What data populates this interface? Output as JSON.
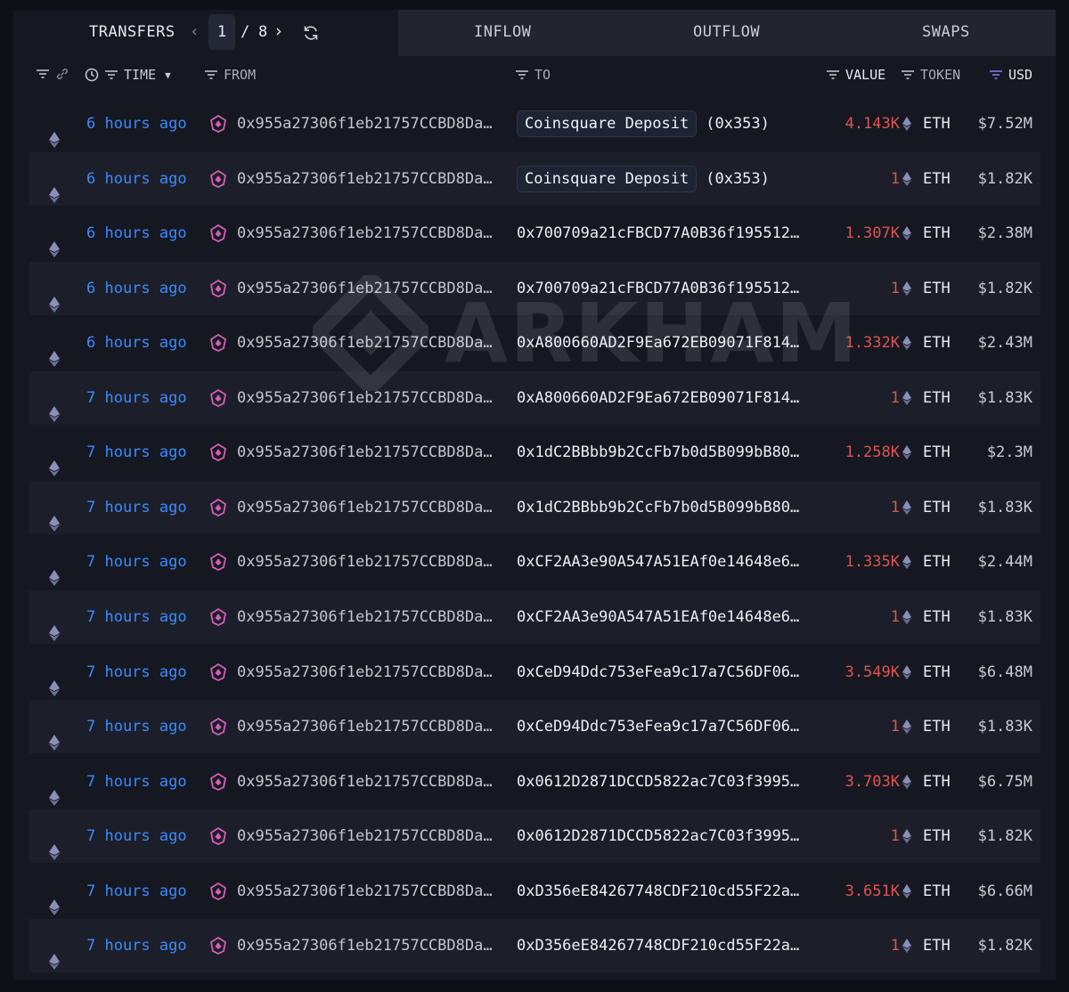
{
  "topbar": {
    "transfers_label": "TRANSFERS",
    "page_current": "1",
    "page_separator": "/",
    "page_total": "8",
    "tabs": [
      {
        "label": "INFLOW"
      },
      {
        "label": "OUTFLOW"
      },
      {
        "label": "SWAPS"
      }
    ]
  },
  "columns": {
    "time": "TIME",
    "from": "FROM",
    "to": "TO",
    "value": "VALUE",
    "token": "TOKEN",
    "usd": "USD"
  },
  "watermark": "ARKHAM",
  "colors": {
    "accent_blue": "#3a8bff",
    "value_red": "#e0534e",
    "usd_filter_purple": "#8b7cff",
    "from_icon_pink": "#d45fb4"
  },
  "rows": [
    {
      "time": "6 hours ago",
      "from": "0x955a27306f1eb21757CCBD8Da…",
      "to_label": "Coinsquare Deposit",
      "to": "(0x353)",
      "value": "4.143K",
      "token": "ETH",
      "usd": "$7.52M"
    },
    {
      "time": "6 hours ago",
      "from": "0x955a27306f1eb21757CCBD8Da…",
      "to_label": "Coinsquare Deposit",
      "to": "(0x353)",
      "value": "1",
      "token": "ETH",
      "usd": "$1.82K"
    },
    {
      "time": "6 hours ago",
      "from": "0x955a27306f1eb21757CCBD8Da…",
      "to_label": "",
      "to": "0x700709a21cFBCD77A0B36f195512…",
      "value": "1.307K",
      "token": "ETH",
      "usd": "$2.38M"
    },
    {
      "time": "6 hours ago",
      "from": "0x955a27306f1eb21757CCBD8Da…",
      "to_label": "",
      "to": "0x700709a21cFBCD77A0B36f195512…",
      "value": "1",
      "token": "ETH",
      "usd": "$1.82K"
    },
    {
      "time": "6 hours ago",
      "from": "0x955a27306f1eb21757CCBD8Da…",
      "to_label": "",
      "to": "0xA800660AD2F9Ea672EB09071F814…",
      "value": "1.332K",
      "token": "ETH",
      "usd": "$2.43M"
    },
    {
      "time": "7 hours ago",
      "from": "0x955a27306f1eb21757CCBD8Da…",
      "to_label": "",
      "to": "0xA800660AD2F9Ea672EB09071F814…",
      "value": "1",
      "token": "ETH",
      "usd": "$1.83K"
    },
    {
      "time": "7 hours ago",
      "from": "0x955a27306f1eb21757CCBD8Da…",
      "to_label": "",
      "to": "0x1dC2BBbb9b2CcFb7b0d5B099bB80…",
      "value": "1.258K",
      "token": "ETH",
      "usd": "$2.3M"
    },
    {
      "time": "7 hours ago",
      "from": "0x955a27306f1eb21757CCBD8Da…",
      "to_label": "",
      "to": "0x1dC2BBbb9b2CcFb7b0d5B099bB80…",
      "value": "1",
      "token": "ETH",
      "usd": "$1.83K"
    },
    {
      "time": "7 hours ago",
      "from": "0x955a27306f1eb21757CCBD8Da…",
      "to_label": "",
      "to": "0xCF2AA3e90A547A51EAf0e14648e6…",
      "value": "1.335K",
      "token": "ETH",
      "usd": "$2.44M"
    },
    {
      "time": "7 hours ago",
      "from": "0x955a27306f1eb21757CCBD8Da…",
      "to_label": "",
      "to": "0xCF2AA3e90A547A51EAf0e14648e6…",
      "value": "1",
      "token": "ETH",
      "usd": "$1.83K"
    },
    {
      "time": "7 hours ago",
      "from": "0x955a27306f1eb21757CCBD8Da…",
      "to_label": "",
      "to": "0xCeD94Ddc753eFea9c17a7C56DF06…",
      "value": "3.549K",
      "token": "ETH",
      "usd": "$6.48M"
    },
    {
      "time": "7 hours ago",
      "from": "0x955a27306f1eb21757CCBD8Da…",
      "to_label": "",
      "to": "0xCeD94Ddc753eFea9c17a7C56DF06…",
      "value": "1",
      "token": "ETH",
      "usd": "$1.83K"
    },
    {
      "time": "7 hours ago",
      "from": "0x955a27306f1eb21757CCBD8Da…",
      "to_label": "",
      "to": "0x0612D2871DCCD5822ac7C03f3995…",
      "value": "3.703K",
      "token": "ETH",
      "usd": "$6.75M"
    },
    {
      "time": "7 hours ago",
      "from": "0x955a27306f1eb21757CCBD8Da…",
      "to_label": "",
      "to": "0x0612D2871DCCD5822ac7C03f3995…",
      "value": "1",
      "token": "ETH",
      "usd": "$1.82K"
    },
    {
      "time": "7 hours ago",
      "from": "0x955a27306f1eb21757CCBD8Da…",
      "to_label": "",
      "to": "0xD356eE84267748CDF210cd55F22a…",
      "value": "3.651K",
      "token": "ETH",
      "usd": "$6.66M"
    },
    {
      "time": "7 hours ago",
      "from": "0x955a27306f1eb21757CCBD8Da…",
      "to_label": "",
      "to": "0xD356eE84267748CDF210cd55F22a…",
      "value": "1",
      "token": "ETH",
      "usd": "$1.82K"
    }
  ]
}
